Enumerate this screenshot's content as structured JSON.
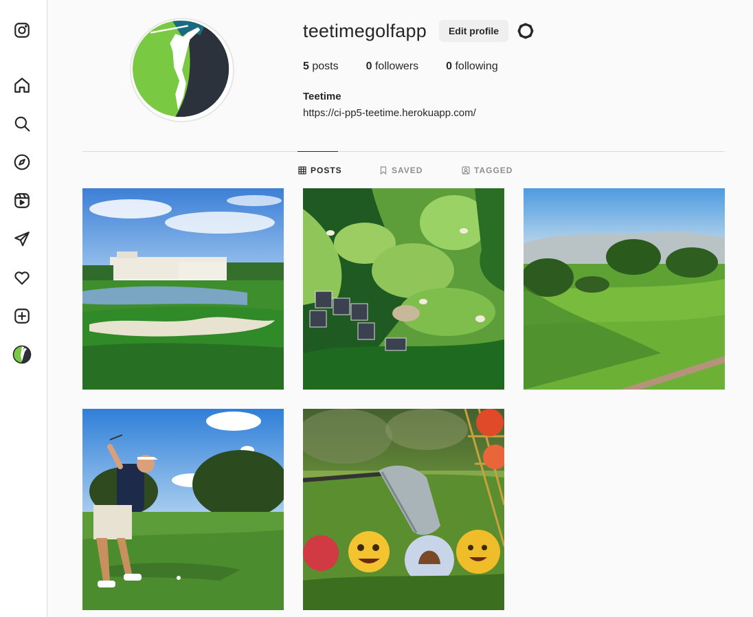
{
  "sidebar": {
    "items": [
      {
        "icon": "instagram-icon",
        "name": "sidebar-logo"
      },
      {
        "icon": "home-icon",
        "name": "sidebar-item-home"
      },
      {
        "icon": "search-icon",
        "name": "sidebar-item-search"
      },
      {
        "icon": "explore-icon",
        "name": "sidebar-item-explore"
      },
      {
        "icon": "reels-icon",
        "name": "sidebar-item-reels"
      },
      {
        "icon": "send-icon",
        "name": "sidebar-item-messages"
      },
      {
        "icon": "heart-icon",
        "name": "sidebar-item-notifications"
      },
      {
        "icon": "plus-square-icon",
        "name": "sidebar-item-create"
      },
      {
        "icon": "profile-avatar-icon",
        "name": "sidebar-item-profile"
      }
    ]
  },
  "profile": {
    "username": "teetimegolfapp",
    "edit_label": "Edit profile",
    "stats": {
      "posts_count": "5",
      "posts_label": "posts",
      "followers_count": "0",
      "followers_label": "followers",
      "following_count": "0",
      "following_label": "following"
    },
    "bio_name": "Teetime",
    "bio_link": "https://ci-pp5-teetime.herokuapp.com/"
  },
  "tabs": [
    {
      "label": "POSTS",
      "icon": "grid-icon",
      "active": true
    },
    {
      "label": "SAVED",
      "icon": "bookmark-icon",
      "active": false
    },
    {
      "label": "TAGGED",
      "icon": "tagged-icon",
      "active": false
    }
  ],
  "colors": {
    "logo_green": "#7ac943",
    "logo_teal": "#1b6b80",
    "logo_dark": "#2b323b"
  },
  "posts": [
    {
      "name": "golf-resort-lake"
    },
    {
      "name": "aerial-golf-course"
    },
    {
      "name": "sunny-fairway"
    },
    {
      "name": "golfer-swing"
    },
    {
      "name": "emoji-golf-balls"
    }
  ]
}
